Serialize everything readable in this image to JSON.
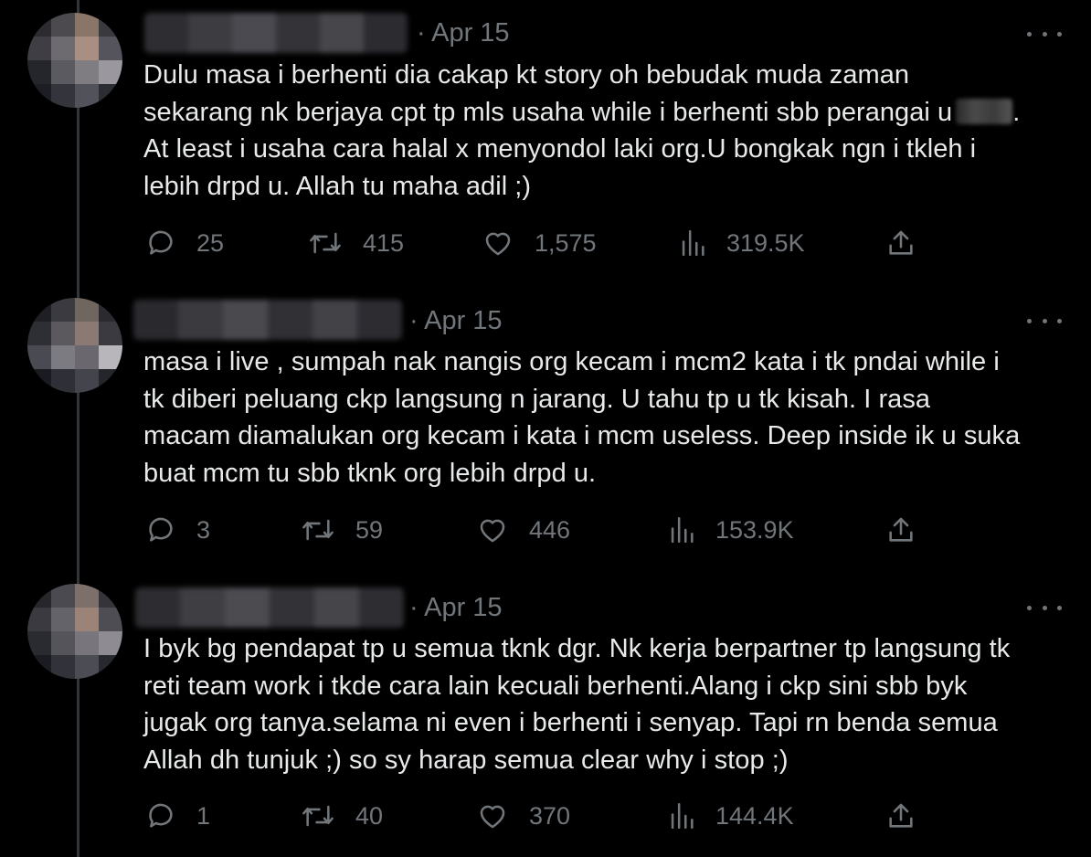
{
  "colors": {
    "background": "#000000",
    "text_primary": "#e7e9ea",
    "text_secondary": "#71767b",
    "thread_line": "#333639"
  },
  "icons": {
    "reply": "reply-icon",
    "retweet": "retweet-icon",
    "like": "like-icon",
    "views": "views-icon",
    "share": "share-icon",
    "more": "more-icon"
  },
  "tweets": [
    {
      "date": "· Apr 15",
      "text": "Dulu masa i berhenti dia cakap kt story oh bebudak muda zaman\nsekarang nk berjaya cpt tp mls usaha while i berhenti sbb perangai u",
      "text_end": ".\nAt least i usaha cara halal x menyondol laki org.U bongkak ngn i tkleh i\nlebih drpd u. Allah tu maha adil ;)",
      "replies": "25",
      "retweets": "415",
      "likes": "1,575",
      "views": "319.5K"
    },
    {
      "date": "· Apr 15",
      "text": "masa i live , sumpah nak nangis org kecam i mcm2 kata i tk pndai while i\ntk diberi peluang ckp langsung n jarang. U tahu tp u tk kisah. I rasa\nmacam diamalukan org kecam i kata i mcm useless. Deep inside ik u suka\nbuat mcm tu sbb tknk org lebih drpd u.",
      "replies": "3",
      "retweets": "59",
      "likes": "446",
      "views": "153.9K"
    },
    {
      "date": "· Apr 15",
      "text": "I byk bg pendapat tp u semua tknk dgr. Nk kerja berpartner tp langsung tk\nreti team work i tkde cara lain kecuali berhenti.Alang i ckp sini sbb byk\njugak org tanya.selama ni even i berhenti i senyap. Tapi rn benda semua\nAllah dh tunjuk ;) so sy harap semua clear why i stop ;)",
      "replies": "1",
      "retweets": "40",
      "likes": "370",
      "views": "144.4K"
    }
  ]
}
